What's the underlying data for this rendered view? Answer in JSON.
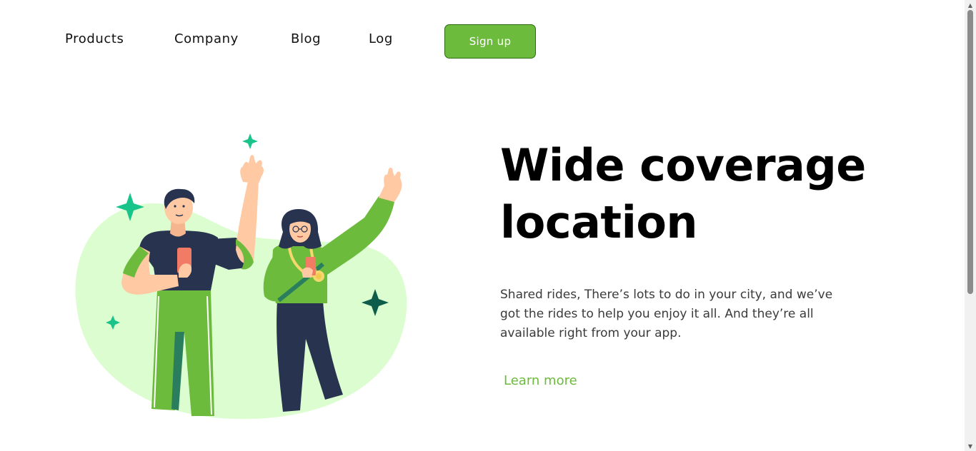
{
  "nav": {
    "links": [
      "Products",
      "Company",
      "Blog",
      "Log"
    ],
    "signup_label": "Sign up"
  },
  "hero": {
    "title": "Wide coverage location",
    "description": "Shared rides, There’s lots to do in your city, and we’ve got the rides to help you enjoy it all. And they’re all available right from your app.",
    "cta_label": "Learn more"
  },
  "colors": {
    "accent": "#6cbb3c",
    "blob": "#dcfdcf",
    "navy": "#283350",
    "sparkle_teal": "#19c48a",
    "sparkle_dark": "#0e5c4a",
    "skin": "#ffc9a3"
  },
  "icons": {
    "scroll_up": "scroll-up-arrow",
    "scroll_down": "scroll-down-arrow"
  }
}
